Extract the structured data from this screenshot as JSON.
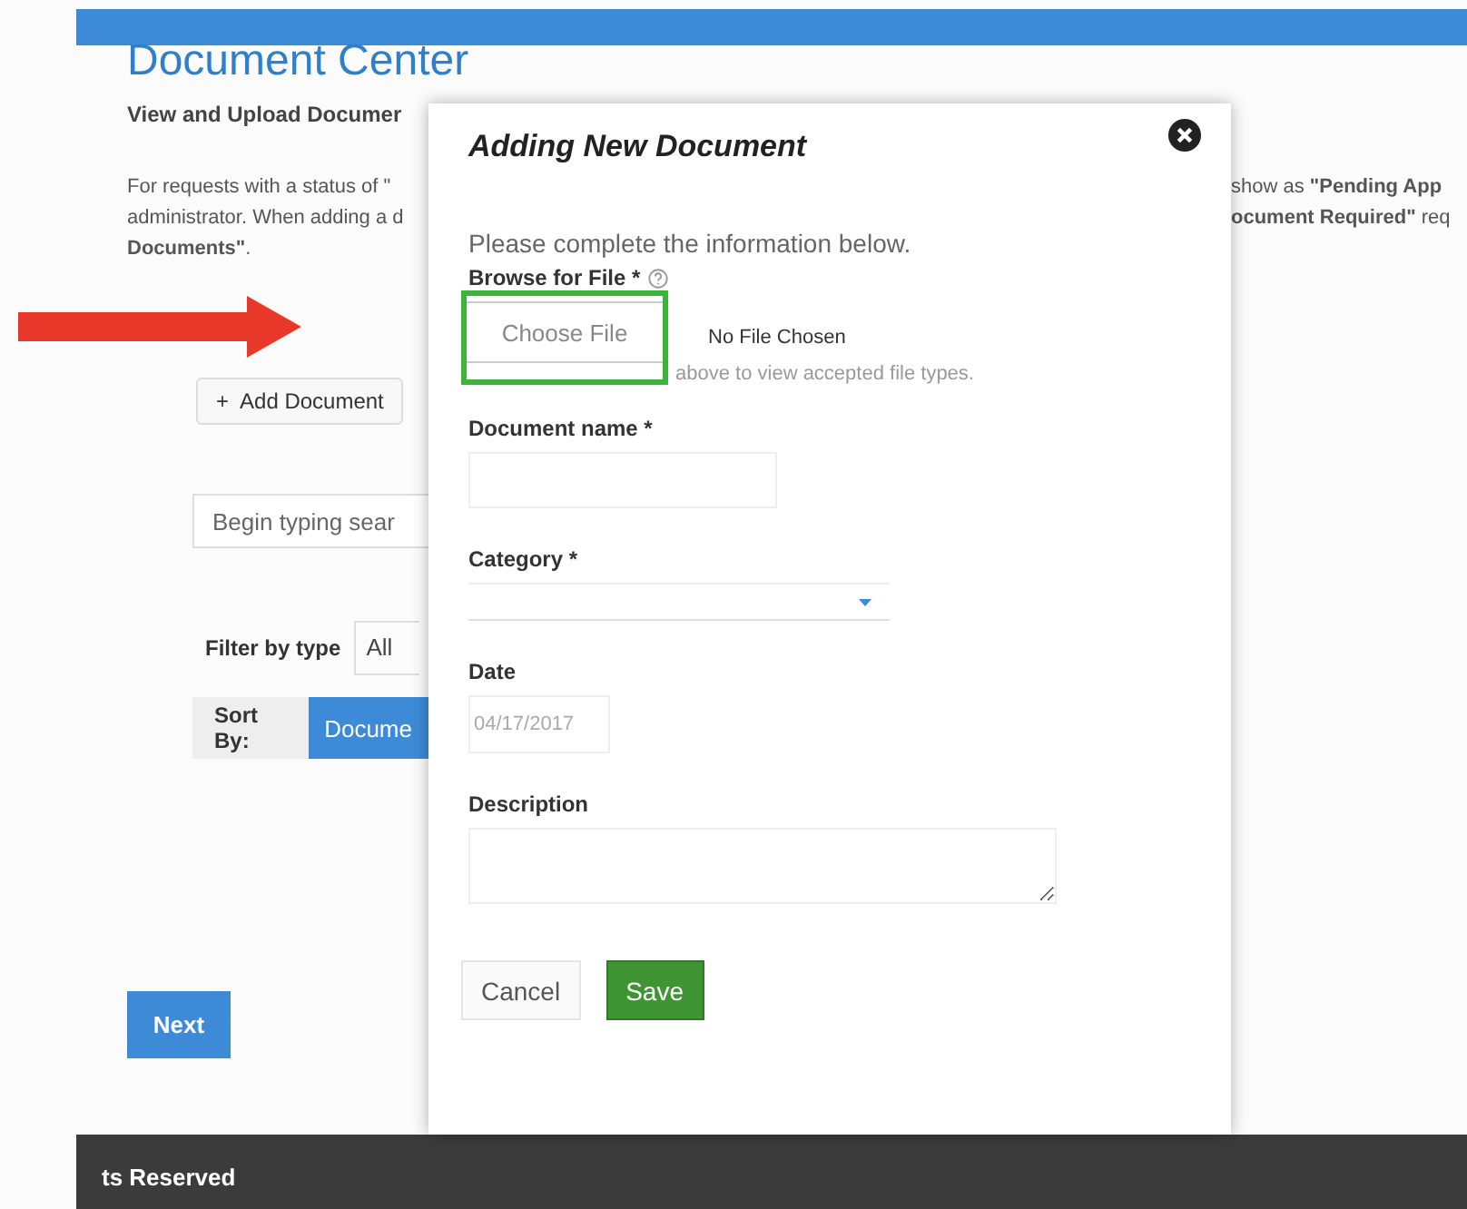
{
  "header": {
    "title": "Document Center",
    "subtitle": "View and Upload Documer"
  },
  "intro": {
    "left_lines": [
      "For requests with a status of \"",
      "administrator. When adding a d",
      "**Documents\"**."
    ],
    "right_lines": [
      "show as **\"Pending App**",
      "**ocument Required\"** req"
    ]
  },
  "add_button": "+  Add Document",
  "search": {
    "placeholder": "Begin typing sear"
  },
  "filter": {
    "label": "Filter by type",
    "value": "All"
  },
  "sort": {
    "label": "Sort By:",
    "options": [
      {
        "label": "Docume",
        "selected": true
      }
    ]
  },
  "next_button": "Next",
  "footer": {
    "text": "ts Reserved"
  },
  "modal": {
    "title": "Adding New Document",
    "intro": "Please complete the information below.",
    "file": {
      "label": "Browse for File *",
      "button": "Choose File",
      "status": "No File Chosen",
      "hint": "above to view accepted file types.",
      "highlighted": true
    },
    "fields": [
      {
        "kind": "text",
        "label": "Document name *"
      },
      {
        "kind": "select",
        "label": "Category *"
      },
      {
        "kind": "date",
        "label": "Date",
        "value": "04/17/2017"
      },
      {
        "kind": "textarea",
        "label": "Description"
      }
    ],
    "buttons": [
      {
        "kind": "secondary",
        "label": "Cancel"
      },
      {
        "kind": "primary",
        "label": "Save"
      }
    ]
  }
}
